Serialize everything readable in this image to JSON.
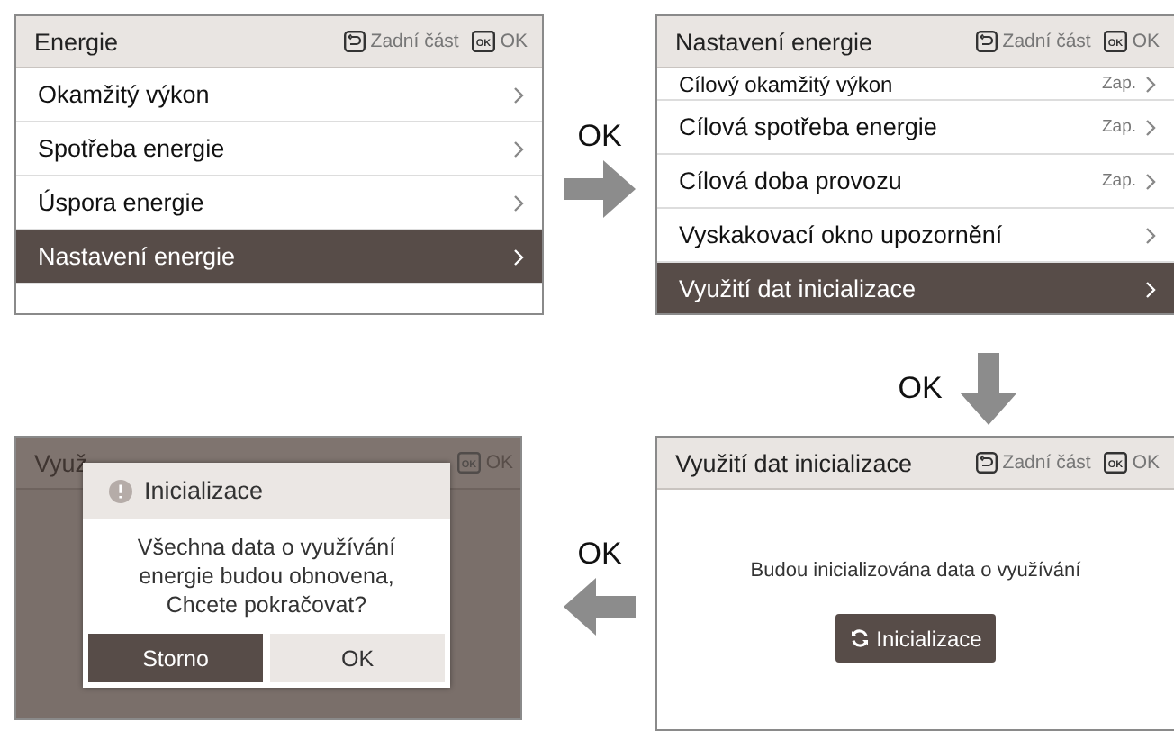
{
  "screens": [
    {
      "kind": "menu",
      "title": "Energie",
      "back_label": "Zadní část",
      "ok_key": "OK",
      "ok_label": "OK",
      "items": [
        {
          "label": "Okamžitý výkon",
          "selected": false
        },
        {
          "label": "Spotřeba energie",
          "selected": false
        },
        {
          "label": "Úspora energie",
          "selected": false
        },
        {
          "label": "Nastavení energie",
          "selected": true
        }
      ]
    },
    {
      "kind": "menu",
      "title": "Nastavení energie",
      "back_label": "Zadní část",
      "ok_key": "OK",
      "ok_label": "OK",
      "items": [
        {
          "label": "Cílový okamžitý výkon",
          "value": "Zap.",
          "selected": false,
          "cut": true
        },
        {
          "label": "Cílová spotřeba energie",
          "value": "Zap.",
          "selected": false
        },
        {
          "label": "Cílová doba provozu",
          "value": "Zap.",
          "selected": false
        },
        {
          "label": "Vyskakovací okno upozornění",
          "selected": false
        },
        {
          "label": "Využití dat inicializace",
          "selected": true
        }
      ]
    },
    {
      "kind": "dialog",
      "title": "Využ",
      "ok_key": "OK",
      "ok_label": "OK",
      "dialog": {
        "title": "Inicializace",
        "message": "Všechna data o využívání energie budou obnovena, Chcete pokračovat?",
        "buttons": [
          {
            "label": "Storno",
            "selected": true
          },
          {
            "label": "OK",
            "selected": false
          }
        ]
      }
    },
    {
      "kind": "confirm",
      "title": "Využití dat inicializace",
      "back_label": "Zadní část",
      "ok_key": "OK",
      "ok_label": "OK",
      "message": "Budou inicializována data o využívání",
      "button": "Inicializace"
    }
  ],
  "transitions": [
    {
      "label": "OK",
      "kind": "right"
    },
    {
      "label": "OK",
      "kind": "down"
    },
    {
      "label": "OK",
      "kind": "left"
    }
  ]
}
